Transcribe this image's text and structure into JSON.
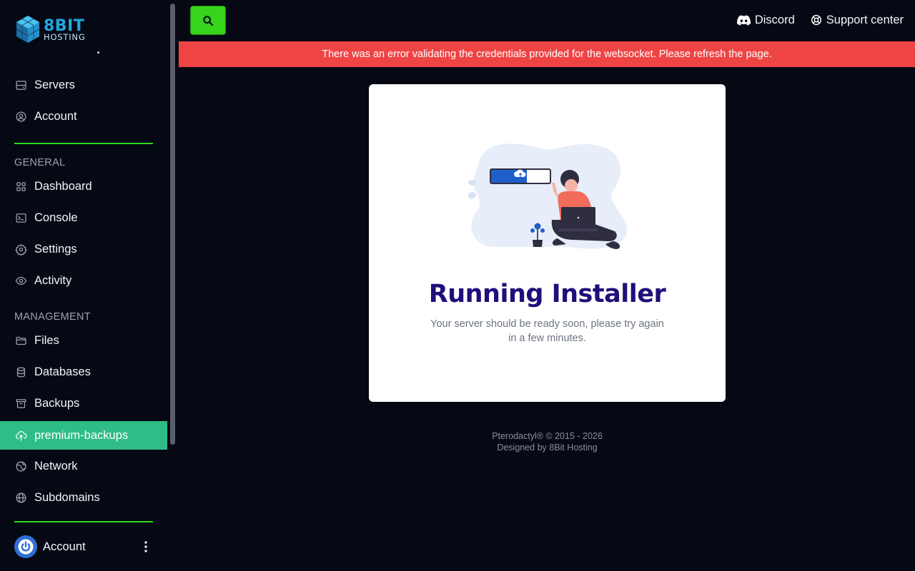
{
  "brand": {
    "name": "8BIT",
    "sub": "HOSTING"
  },
  "sidebar": {
    "top_items": [
      {
        "label": "Servers",
        "icon": "server-icon"
      },
      {
        "label": "Account",
        "icon": "user-circle-icon"
      }
    ],
    "general_label": "GENERAL",
    "general_items": [
      {
        "label": "Dashboard",
        "icon": "grid-icon"
      },
      {
        "label": "Console",
        "icon": "terminal-icon"
      },
      {
        "label": "Settings",
        "icon": "gear-icon"
      },
      {
        "label": "Activity",
        "icon": "eye-icon"
      }
    ],
    "management_label": "MANAGEMENT",
    "management_items": [
      {
        "label": "Files",
        "icon": "folder-icon"
      },
      {
        "label": "Databases",
        "icon": "database-icon"
      },
      {
        "label": "Backups",
        "icon": "archive-icon"
      },
      {
        "label": "premium-backups",
        "icon": "cloud-upload-icon",
        "active": true
      },
      {
        "label": "Network",
        "icon": "globe-network-icon"
      },
      {
        "label": "Subdomains",
        "icon": "globe-icon"
      }
    ],
    "footer_account_label": "Account"
  },
  "topbar": {
    "discord_label": "Discord",
    "support_label": "Support center"
  },
  "error_banner": "There was an error validating the credentials provided for the websocket. Please refresh the page.",
  "card": {
    "title": "Running Installer",
    "text": "Your server should be ready soon, please try again in a few minutes."
  },
  "footer": {
    "line1": "Pterodactyl® © 2015 - 2026",
    "line2": "Designed by 8Bit Hosting"
  },
  "colors": {
    "accent_green": "#36d41b",
    "active_item": "#2ebd87",
    "error": "#ef4444",
    "title": "#1e0f7a",
    "background": "#060914"
  }
}
